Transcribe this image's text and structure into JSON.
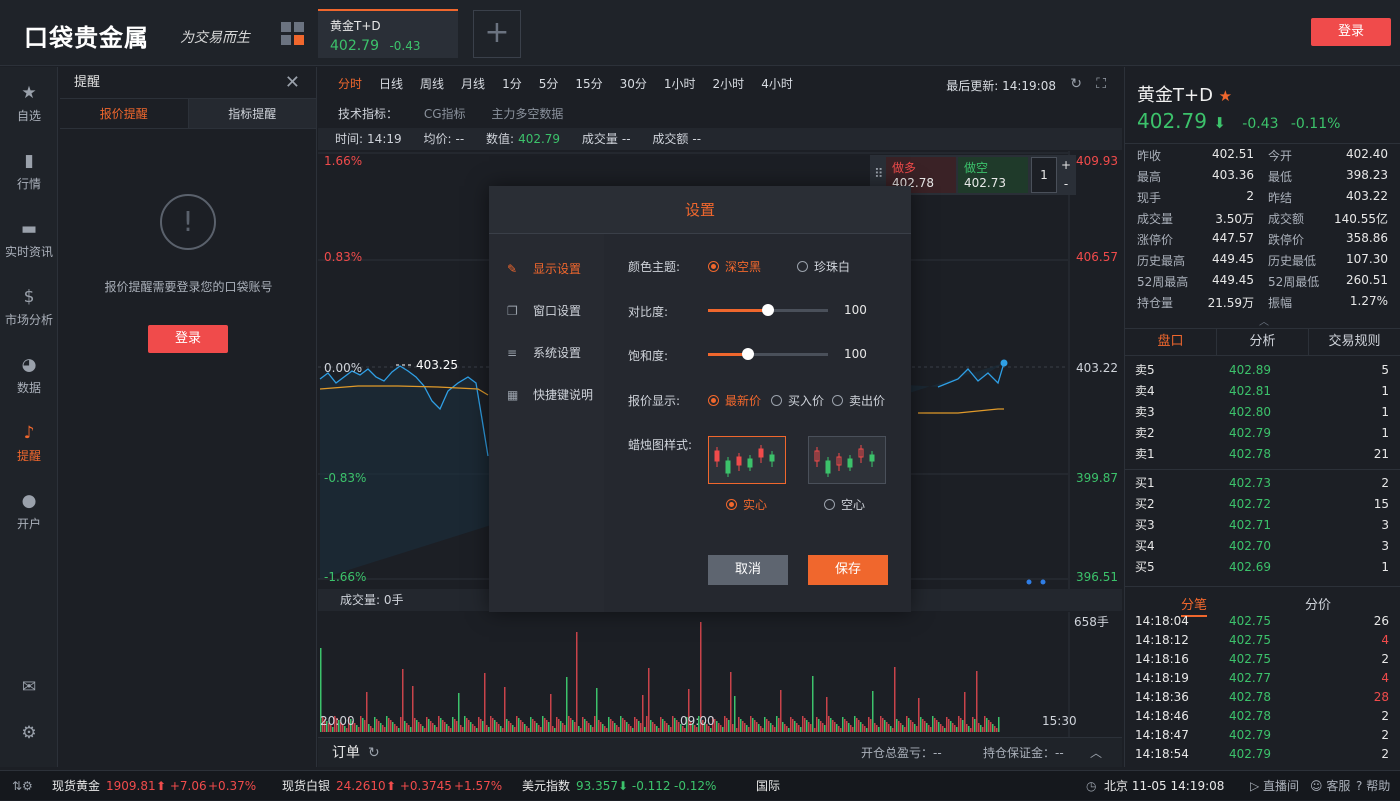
{
  "header": {
    "logo": "口袋贵金属",
    "slogan": "为交易而生",
    "tab": {
      "name": "黄金T+D",
      "price": "402.79",
      "change": "-0.43"
    },
    "add": "+",
    "login": "登录"
  },
  "nav": [
    {
      "label": "自选",
      "icon": "★"
    },
    {
      "label": "行情",
      "icon": "▮"
    },
    {
      "label": "实时资讯",
      "icon": "▬"
    },
    {
      "label": "市场分析",
      "icon": "$"
    },
    {
      "label": "数据",
      "icon": "◕"
    },
    {
      "label": "提醒",
      "icon": "♪"
    },
    {
      "label": "开户",
      "icon": "●"
    }
  ],
  "nav_bottom": {
    "mail_icon": "✉",
    "settings_icon": "⚙"
  },
  "alert": {
    "title": "提醒",
    "close": "✕",
    "tabs": [
      "报价提醒",
      "指标提醒"
    ],
    "icon": "!",
    "message": "报价提醒需要登录您的口袋账号",
    "login": "登录"
  },
  "chart": {
    "periods": [
      "分时",
      "日线",
      "周线",
      "月线",
      "1分",
      "5分",
      "15分",
      "30分",
      "1小时",
      "2小时",
      "4小时"
    ],
    "last_update": "最后更新: 14:19:08",
    "indicators": {
      "label": "技术指标：",
      "items": [
        "CG指标",
        "主力多空数据"
      ]
    },
    "info": {
      "time_label": "时间:",
      "time": "14:19",
      "avg_label": "均价:",
      "avg": "--",
      "val_label": "数值:",
      "val": "402.79",
      "vol_label": "成交量",
      "vol": "--",
      "amt_label": "成交额",
      "amt": "--"
    },
    "left_axis": [
      "1.66%",
      "0.83%",
      "0.00%",
      "-0.83%",
      "-1.66%"
    ],
    "right_axis": [
      "409.93",
      "406.57",
      "403.22",
      "399.87",
      "396.51"
    ],
    "marker": "403.25",
    "trade": {
      "buy_label": "做多",
      "buy_price": "402.78",
      "sell_label": "做空",
      "sell_price": "402.73",
      "qty": "1",
      "plus": "+",
      "minus": "-"
    },
    "volume_label": "成交量: 0手",
    "volume_max": "658手",
    "time_axis": [
      "20:00",
      "09:00",
      "15:30"
    ],
    "order": {
      "label": "订单",
      "open_pnl": "开仓总盈亏：--",
      "margin": "持仓保证金：--",
      "collapse": "︿"
    }
  },
  "dialog": {
    "title": "设置",
    "menu": [
      {
        "label": "显示设置",
        "icon": "✎"
      },
      {
        "label": "窗口设置",
        "icon": "❐"
      },
      {
        "label": "系统设置",
        "icon": "≡"
      },
      {
        "label": "快捷键说明",
        "icon": "▦"
      }
    ],
    "theme_label": "颜色主题:",
    "theme_options": [
      "深空黑",
      "珍珠白"
    ],
    "contrast_label": "对比度:",
    "contrast": "100",
    "contrast_level": 0.5,
    "saturation_label": "饱和度:",
    "saturation": "100",
    "saturation_level": 0.33,
    "price_label": "报价显示:",
    "price_options": [
      "最新价",
      "买入价",
      "卖出价"
    ],
    "candle_label": "蜡烛图样式:",
    "candle_options": [
      "实心",
      "空心"
    ],
    "cancel": "取消",
    "save": "保存"
  },
  "product": {
    "name": "黄金T+D",
    "star": "★",
    "price": "402.79",
    "arrow": "⬇",
    "change": "-0.43",
    "pct": "-0.11%",
    "stats": [
      [
        "昨收",
        "402.51",
        "今开",
        "402.40"
      ],
      [
        "最高",
        "403.36",
        "最低",
        "398.23"
      ],
      [
        "现手",
        "2",
        "昨结",
        "403.22"
      ],
      [
        "成交量",
        "3.50万",
        "成交额",
        "140.55亿"
      ],
      [
        "涨停价",
        "447.57",
        "跌停价",
        "358.86"
      ],
      [
        "历史最高",
        "449.45",
        "历史最低",
        "107.30"
      ],
      [
        "52周最高",
        "449.45",
        "52周最低",
        "260.51"
      ],
      [
        "持仓量",
        "21.59万",
        "振幅",
        "1.27%"
      ]
    ],
    "tabs": [
      "盘口",
      "分析",
      "交易规则"
    ],
    "asks": [
      [
        "卖5",
        "402.89",
        "5"
      ],
      [
        "卖4",
        "402.81",
        "1"
      ],
      [
        "卖3",
        "402.80",
        "1"
      ],
      [
        "卖2",
        "402.79",
        "1"
      ],
      [
        "卖1",
        "402.78",
        "21"
      ]
    ],
    "bids": [
      [
        "买1",
        "402.73",
        "2"
      ],
      [
        "买2",
        "402.72",
        "15"
      ],
      [
        "买3",
        "402.71",
        "3"
      ],
      [
        "买4",
        "402.70",
        "3"
      ],
      [
        "买5",
        "402.69",
        "1"
      ]
    ],
    "tick_tabs": [
      "分笔",
      "分价"
    ],
    "ticks": [
      [
        "14:18:04",
        "402.75",
        "26"
      ],
      [
        "14:18:12",
        "402.75",
        "4"
      ],
      [
        "14:18:16",
        "402.75",
        "2"
      ],
      [
        "14:18:19",
        "402.77",
        "4"
      ],
      [
        "14:18:36",
        "402.78",
        "28"
      ],
      [
        "14:18:46",
        "402.78",
        "2"
      ],
      [
        "14:18:47",
        "402.79",
        "2"
      ],
      [
        "14:18:54",
        "402.79",
        "2"
      ]
    ]
  },
  "status": {
    "gold_name": "现货黄金",
    "gold_price": "1909.81",
    "gold_chg": "⬆ +7.06",
    "gold_pct": "+0.37%",
    "silver_name": "现货白银",
    "silver_price": "24.2610",
    "silver_chg": "⬆ +0.3745",
    "silver_pct": "+1.57%",
    "usd_name": "美元指数",
    "usd_price": "93.357",
    "usd_chg": "⬇ -0.112",
    "usd_pct": "-0.12%",
    "intl": "国际",
    "clock": "北京  11-05 14:19:08",
    "live": "直播间",
    "service": "客服",
    "help": "帮助"
  },
  "colors": {
    "accent": "#f0672d",
    "up": "#f04b4b",
    "down": "#3cc26b"
  }
}
